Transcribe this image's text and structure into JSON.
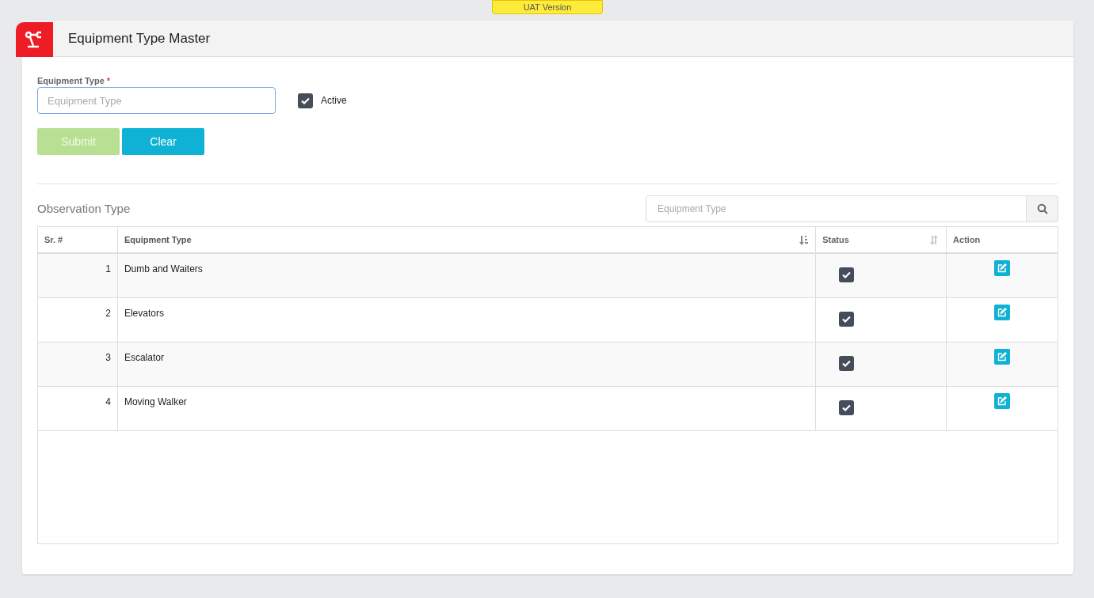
{
  "banner": "UAT Version",
  "header": {
    "title": "Equipment Type Master"
  },
  "form": {
    "label": "Equipment Type",
    "required_mark": "*",
    "placeholder": "Equipment Type",
    "active": {
      "label": "Active",
      "checked": true
    },
    "buttons": [
      {
        "kind": "submit",
        "label": "Submit",
        "disabled": true
      },
      {
        "kind": "clear",
        "label": "Clear",
        "disabled": false
      }
    ]
  },
  "list": {
    "title": "Observation Type",
    "search": {
      "placeholder": "Equipment Type"
    },
    "table": {
      "columns": [
        {
          "label": "Sr. #",
          "sortable": false,
          "sorted": false
        },
        {
          "label": "Equipment Type",
          "sortable": true,
          "sorted": true
        },
        {
          "label": "Status",
          "sortable": true,
          "sorted": false
        },
        {
          "label": "Action",
          "sortable": false,
          "sorted": false
        }
      ],
      "rows": [
        {
          "sr": "1",
          "name": "Dumb and Waiters",
          "active": true
        },
        {
          "sr": "2",
          "name": "Elevators",
          "active": true
        },
        {
          "sr": "3",
          "name": "Escalator",
          "active": true
        },
        {
          "sr": "4",
          "name": "Moving Walker",
          "active": true
        }
      ]
    }
  }
}
